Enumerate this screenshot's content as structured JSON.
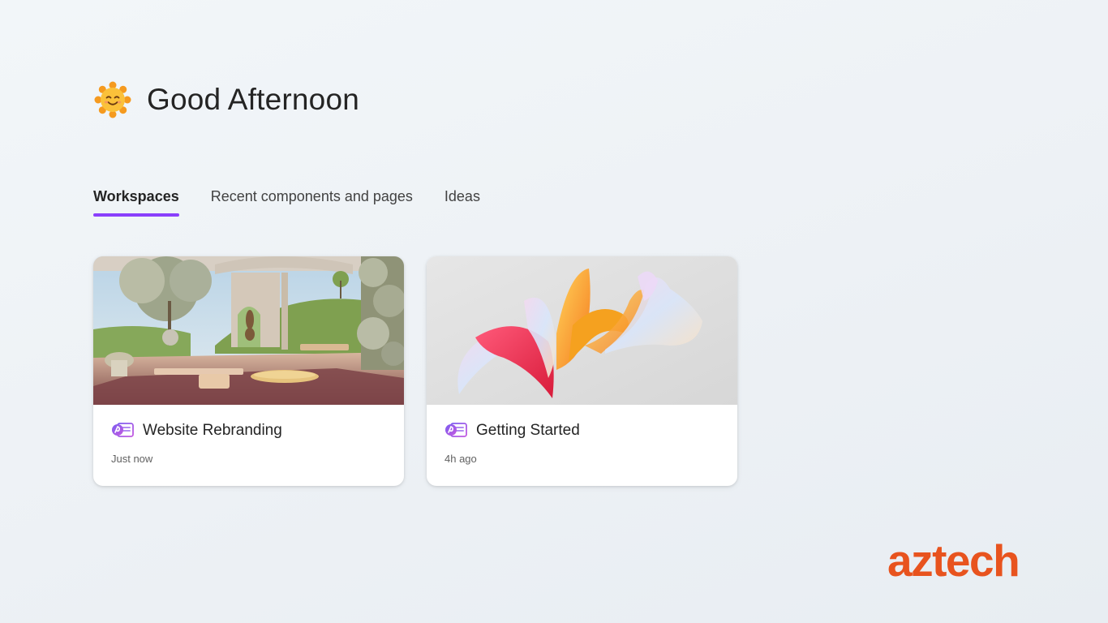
{
  "greeting": {
    "title": "Good Afternoon",
    "icon": "smiling-sun-icon"
  },
  "tabs": [
    {
      "label": "Workspaces",
      "active": true
    },
    {
      "label": "Recent components and pages",
      "active": false
    },
    {
      "label": "Ideas",
      "active": false
    }
  ],
  "workspaces": [
    {
      "title": "Website Rebranding",
      "time": "Just now",
      "icon": "loop-workspace-icon",
      "thumbnail": "terrace-garden-image"
    },
    {
      "title": "Getting Started",
      "time": "4h ago",
      "icon": "loop-workspace-icon",
      "thumbnail": "abstract-ribbons-image"
    }
  ],
  "brand": {
    "logo_text": "aztech",
    "color": "#e8531e"
  },
  "colors": {
    "accent": "#8a3ffc",
    "background": "#eef2f6"
  }
}
